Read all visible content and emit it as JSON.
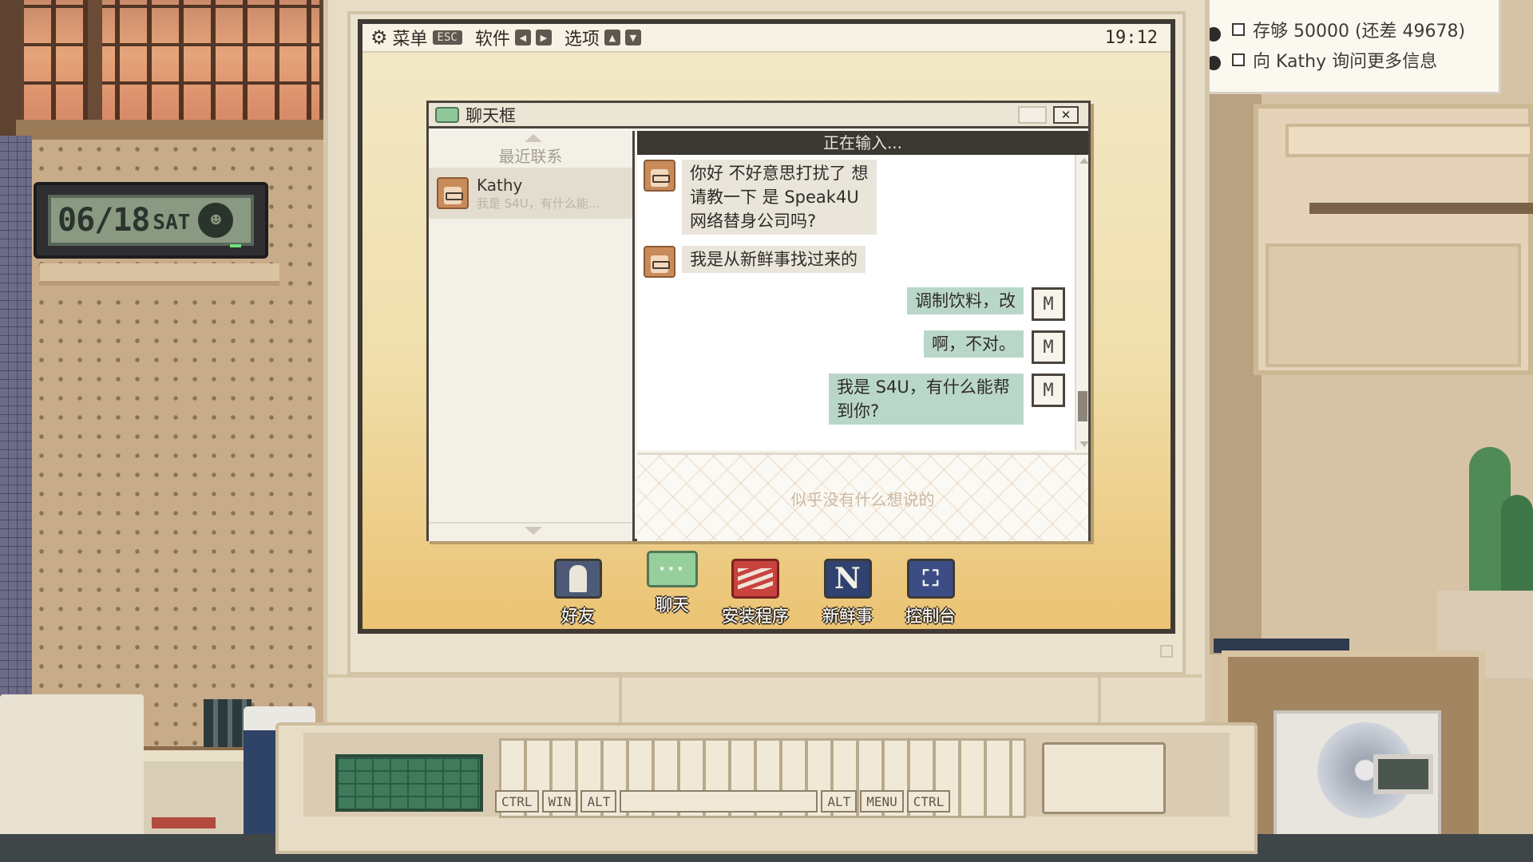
{
  "tasks": [
    {
      "label": "存够 50000 (还差 49678)"
    },
    {
      "label": "向 Kathy 询问更多信息"
    }
  ],
  "clock": {
    "date": "06/18",
    "day": "SAT"
  },
  "menubar": {
    "menu_label": "菜单",
    "esc_label": "ESC",
    "software_label": "软件",
    "options_label": "选项",
    "time": "19:12"
  },
  "chat_window": {
    "title": "聊天框",
    "close_symbol": "✕",
    "contacts_header": "最近联系",
    "contact": {
      "name": "Kathy",
      "preview": "我是 S4U，有什么能…"
    },
    "status": "正在输入...",
    "messages": [
      {
        "from": "Kathy",
        "text": "你好 不好意思打扰了 想请教一下 是 Speak4U 网络替身公司吗?"
      },
      {
        "from": "Kathy",
        "text": "我是从新鲜事找过来的"
      },
      {
        "from": "me",
        "text": "调制饮料，改"
      },
      {
        "from": "me",
        "text": "啊，不对。"
      },
      {
        "from": "me",
        "text": "我是 S4U，有什么能帮到你?"
      }
    ],
    "input_placeholder": "似乎没有什么想说的"
  },
  "dock": [
    {
      "label": "好友",
      "icon": "friends-icon"
    },
    {
      "label": "聊天",
      "icon": "chat-icon"
    },
    {
      "label": "安装程序",
      "icon": "installer-icon"
    },
    {
      "label": "新鲜事",
      "icon": "news-icon"
    },
    {
      "label": "控制台",
      "icon": "console-icon"
    }
  ],
  "keyboard": {
    "keys": [
      "CTRL",
      "WIN",
      "ALT",
      "ALT",
      "MENU",
      "CTRL"
    ]
  },
  "colors": {
    "accent_green": "#b9d7c8",
    "screen_bg": "#f0dfac",
    "dark": "#3b3733"
  }
}
